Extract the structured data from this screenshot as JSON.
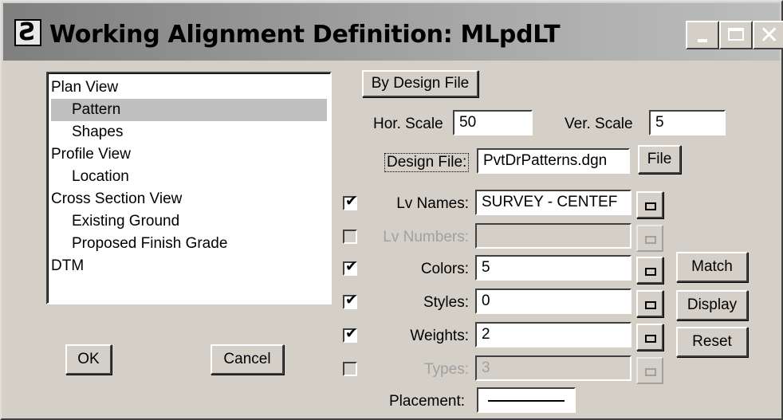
{
  "window": {
    "title": "Working Alignment Definition: MLpdLT",
    "app_icon": "micro-station-icon",
    "controls": [
      "minimize-icon",
      "maximize-icon",
      "close-icon"
    ]
  },
  "tree": {
    "items": [
      {
        "label": "Plan View",
        "level": 0,
        "selected": false
      },
      {
        "label": "Pattern",
        "level": 1,
        "selected": true
      },
      {
        "label": "Shapes",
        "level": 1,
        "selected": false
      },
      {
        "label": "Profile View",
        "level": 0,
        "selected": false
      },
      {
        "label": "Location",
        "level": 1,
        "selected": false
      },
      {
        "label": "Cross Section View",
        "level": 0,
        "selected": false
      },
      {
        "label": "Existing Ground",
        "level": 1,
        "selected": false
      },
      {
        "label": "Proposed Finish Grade",
        "level": 1,
        "selected": false
      },
      {
        "label": "DTM",
        "level": 0,
        "selected": false
      }
    ]
  },
  "buttons": {
    "by_design_file": "By Design File",
    "file": "File",
    "ok": "OK",
    "cancel": "Cancel",
    "match": "Match",
    "display": "Display",
    "reset": "Reset"
  },
  "scale": {
    "hor_label": "Hor. Scale",
    "hor_value": "50",
    "ver_label": "Ver. Scale",
    "ver_value": "5"
  },
  "design_file": {
    "label": "Design File:",
    "value": "PvtDrPatterns.dgn"
  },
  "symbology": {
    "lv_names": {
      "label": "Lv Names:",
      "value": "SURVEY - CENTEF",
      "checked": true,
      "enabled": true
    },
    "lv_numbers": {
      "label": "Lv Numbers:",
      "value": "",
      "checked": false,
      "enabled": false
    },
    "colors": {
      "label": "Colors:",
      "value": "5",
      "checked": true,
      "enabled": true
    },
    "styles": {
      "label": "Styles:",
      "value": "0",
      "checked": true,
      "enabled": true
    },
    "weights": {
      "label": "Weights:",
      "value": "2",
      "checked": true,
      "enabled": true
    },
    "types": {
      "label": "Types:",
      "value": "3",
      "checked": false,
      "enabled": false
    }
  },
  "placement": {
    "label": "Placement:"
  },
  "checkmark": "☑"
}
